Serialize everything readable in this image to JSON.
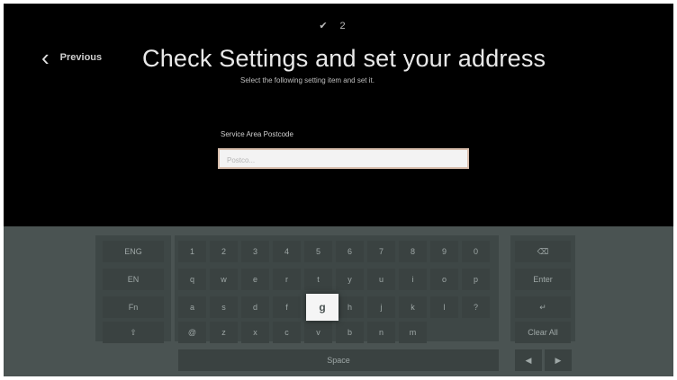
{
  "steps": [
    "✔",
    "2"
  ],
  "header": {
    "previous_label": "Previous",
    "title": "Check Settings and set your address",
    "subtitle": "Select the following setting item and set it."
  },
  "form": {
    "field_label": "Service Area Postcode",
    "placeholder": "Postco..."
  },
  "keyboard": {
    "left_keys": [
      "ENG",
      "EN",
      "Fn",
      "⇧"
    ],
    "rows": [
      [
        "1",
        "2",
        "3",
        "4",
        "5",
        "6",
        "7",
        "8",
        "9",
        "0"
      ],
      [
        "q",
        "w",
        "e",
        "r",
        "t",
        "y",
        "u",
        "i",
        "o",
        "p"
      ],
      [
        "a",
        "s",
        "d",
        "f",
        "g",
        "h",
        "j",
        "k",
        "l",
        "?"
      ],
      [
        "@",
        "z",
        "x",
        "c",
        "v",
        "b",
        "n",
        "m"
      ]
    ],
    "right_keys": [
      "⌫",
      "Enter",
      "↵",
      "Clear All"
    ],
    "space_label": "Space",
    "focused_key": "g"
  },
  "colors": {
    "background": "#000000",
    "keyboard_bg": "#4a5352",
    "key_bg": "#3a4241",
    "focus_bg": "#f5f5f5",
    "input_border": "#d9bfae"
  }
}
